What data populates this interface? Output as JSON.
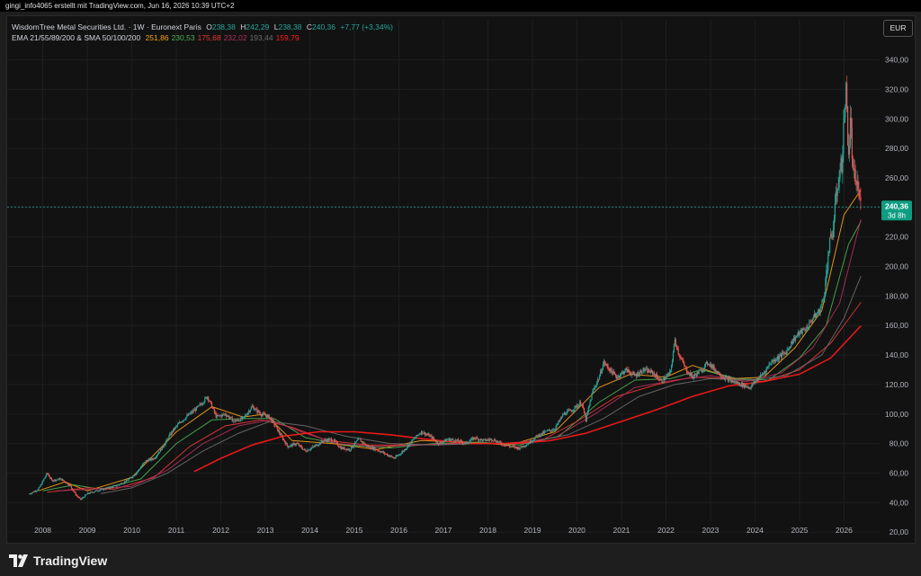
{
  "header": {
    "text": "gingi_info4065 erstellt mit TradingView.com, Jun 16, 2026 10:39 UTC+2"
  },
  "legend": {
    "instrument": "WisdomTree Metal Securities Ltd. · 1W · Euronext Paris",
    "o_label": "O",
    "o_value": "238,38",
    "h_label": "H",
    "h_value": "242,29",
    "l_label": "L",
    "l_value": "238,38",
    "c_label": "C",
    "c_value": "240,36",
    "change": "+7,77 (+3,34%)",
    "indicator_name": "EMA 21/55/89/200 & SMA 50/100/200",
    "indicator_values": [
      {
        "value": "251,86",
        "color": "#f7a21b"
      },
      {
        "value": "230,53",
        "color": "#4caf50"
      },
      {
        "value": "175,68",
        "color": "#e53935"
      },
      {
        "value": "232,02",
        "color": "#b0305a"
      },
      {
        "value": "193,44",
        "color": "#6d6d6d"
      },
      {
        "value": "159,79",
        "color": "#ff1a1a"
      }
    ]
  },
  "currency": "EUR",
  "price_badge": {
    "price": "240,36",
    "countdown": "3d 8h"
  },
  "footer": {
    "brand": "TradingView"
  },
  "chart_data": {
    "type": "candlestick",
    "ylim": [
      14,
      355
    ],
    "y_ticks": [
      20,
      40,
      60,
      80,
      100,
      120,
      140,
      160,
      180,
      200,
      220,
      240,
      260,
      280,
      300,
      320,
      340
    ],
    "y_tick_labels": [
      "20,00",
      "40,00",
      "60,00",
      "80,00",
      "100,00",
      "120,00",
      "140,00",
      "160,00",
      "180,00",
      "200,00",
      "220,00",
      "240,00",
      "260,00",
      "280,00",
      "300,00",
      "320,00",
      "340,00"
    ],
    "x_ticks": [
      2008,
      2009,
      2010,
      2011,
      2012,
      2013,
      2014,
      2015,
      2016,
      2017,
      2018,
      2019,
      2020,
      2021,
      2022,
      2023,
      2024,
      2025,
      2026
    ],
    "x_range": [
      2007.2,
      2026.8
    ],
    "last_price": 240.36,
    "colors": {
      "up": "#26a69a",
      "down": "#ef5350",
      "grid": "#1f1f1f",
      "axis_text": "#b2b5be",
      "current_line": "#26a69a",
      "badge": "#0f9d82"
    },
    "close_series": [
      [
        2007.7,
        46
      ],
      [
        2007.9,
        49
      ],
      [
        2008.1,
        60
      ],
      [
        2008.2,
        55
      ],
      [
        2008.4,
        56
      ],
      [
        2008.6,
        52
      ],
      [
        2008.75,
        45
      ],
      [
        2008.85,
        42
      ],
      [
        2009.0,
        46
      ],
      [
        2009.2,
        48
      ],
      [
        2009.5,
        50
      ],
      [
        2009.7,
        52
      ],
      [
        2009.9,
        55
      ],
      [
        2010.1,
        60
      ],
      [
        2010.3,
        68
      ],
      [
        2010.5,
        70
      ],
      [
        2010.7,
        78
      ],
      [
        2010.9,
        88
      ],
      [
        2011.1,
        95
      ],
      [
        2011.3,
        100
      ],
      [
        2011.5,
        105
      ],
      [
        2011.7,
        112
      ],
      [
        2011.9,
        98
      ],
      [
        2012.1,
        100
      ],
      [
        2012.3,
        95
      ],
      [
        2012.5,
        97
      ],
      [
        2012.7,
        105
      ],
      [
        2012.9,
        100
      ],
      [
        2013.1,
        98
      ],
      [
        2013.3,
        88
      ],
      [
        2013.5,
        78
      ],
      [
        2013.7,
        80
      ],
      [
        2013.9,
        75
      ],
      [
        2014.1,
        78
      ],
      [
        2014.3,
        82
      ],
      [
        2014.5,
        83
      ],
      [
        2014.7,
        77
      ],
      [
        2014.9,
        76
      ],
      [
        2015.1,
        83
      ],
      [
        2015.3,
        78
      ],
      [
        2015.5,
        76
      ],
      [
        2015.7,
        73
      ],
      [
        2015.9,
        70
      ],
      [
        2016.1,
        75
      ],
      [
        2016.3,
        82
      ],
      [
        2016.5,
        88
      ],
      [
        2016.7,
        85
      ],
      [
        2016.9,
        80
      ],
      [
        2017.1,
        83
      ],
      [
        2017.3,
        82
      ],
      [
        2017.5,
        80
      ],
      [
        2017.7,
        84
      ],
      [
        2017.9,
        82
      ],
      [
        2018.1,
        83
      ],
      [
        2018.3,
        80
      ],
      [
        2018.5,
        78
      ],
      [
        2018.7,
        77
      ],
      [
        2018.9,
        80
      ],
      [
        2019.1,
        85
      ],
      [
        2019.3,
        88
      ],
      [
        2019.5,
        90
      ],
      [
        2019.7,
        100
      ],
      [
        2019.9,
        103
      ],
      [
        2020.1,
        108
      ],
      [
        2020.2,
        96
      ],
      [
        2020.35,
        115
      ],
      [
        2020.5,
        125
      ],
      [
        2020.6,
        135
      ],
      [
        2020.8,
        128
      ],
      [
        2020.9,
        125
      ],
      [
        2021.1,
        130
      ],
      [
        2021.3,
        126
      ],
      [
        2021.5,
        130
      ],
      [
        2021.7,
        128
      ],
      [
        2021.9,
        122
      ],
      [
        2022.0,
        125
      ],
      [
        2022.1,
        128
      ],
      [
        2022.2,
        150
      ],
      [
        2022.3,
        140
      ],
      [
        2022.45,
        130
      ],
      [
        2022.6,
        125
      ],
      [
        2022.8,
        130
      ],
      [
        2022.95,
        135
      ],
      [
        2023.1,
        130
      ],
      [
        2023.3,
        125
      ],
      [
        2023.5,
        122
      ],
      [
        2023.7,
        120
      ],
      [
        2023.9,
        118
      ],
      [
        2024.0,
        122
      ],
      [
        2024.2,
        128
      ],
      [
        2024.35,
        135
      ],
      [
        2024.5,
        138
      ],
      [
        2024.7,
        142
      ],
      [
        2024.85,
        150
      ],
      [
        2025.0,
        155
      ],
      [
        2025.15,
        158
      ],
      [
        2025.3,
        165
      ],
      [
        2025.45,
        170
      ],
      [
        2025.55,
        180
      ],
      [
        2025.65,
        210
      ],
      [
        2025.75,
        225
      ],
      [
        2025.85,
        255
      ],
      [
        2025.95,
        270
      ],
      [
        2026.0,
        300
      ],
      [
        2026.05,
        320
      ],
      [
        2026.1,
        275
      ],
      [
        2026.15,
        300
      ],
      [
        2026.2,
        262
      ],
      [
        2026.3,
        255
      ],
      [
        2026.38,
        240.36
      ]
    ],
    "series": [
      {
        "color": "#f7a21b",
        "points": [
          [
            2007.9,
            48
          ],
          [
            2008.5,
            54
          ],
          [
            2009.0,
            48
          ],
          [
            2010.0,
            57
          ],
          [
            2011.0,
            88
          ],
          [
            2011.8,
            105
          ],
          [
            2012.5,
            98
          ],
          [
            2013.0,
            100
          ],
          [
            2013.6,
            82
          ],
          [
            2014.5,
            80
          ],
          [
            2015.5,
            76
          ],
          [
            2016.5,
            82
          ],
          [
            2017.5,
            81
          ],
          [
            2018.5,
            79
          ],
          [
            2019.5,
            88
          ],
          [
            2020.5,
            118
          ],
          [
            2021.2,
            127
          ],
          [
            2022.0,
            125
          ],
          [
            2022.6,
            133
          ],
          [
            2023.5,
            124
          ],
          [
            2024.2,
            125
          ],
          [
            2024.9,
            145
          ],
          [
            2025.5,
            170
          ],
          [
            2026.0,
            235
          ],
          [
            2026.38,
            251.86
          ]
        ]
      },
      {
        "color": "#4caf50",
        "points": [
          [
            2008.0,
            48
          ],
          [
            2008.7,
            52
          ],
          [
            2009.3,
            49
          ],
          [
            2010.2,
            56
          ],
          [
            2011.0,
            80
          ],
          [
            2011.8,
            96
          ],
          [
            2012.6,
            97
          ],
          [
            2013.2,
            97
          ],
          [
            2013.9,
            84
          ],
          [
            2014.8,
            79
          ],
          [
            2015.8,
            77
          ],
          [
            2016.8,
            80
          ],
          [
            2017.8,
            81
          ],
          [
            2018.7,
            79
          ],
          [
            2019.6,
            85
          ],
          [
            2020.5,
            108
          ],
          [
            2021.3,
            123
          ],
          [
            2022.1,
            124
          ],
          [
            2022.8,
            130
          ],
          [
            2023.6,
            124
          ],
          [
            2024.3,
            123
          ],
          [
            2025.0,
            138
          ],
          [
            2025.6,
            160
          ],
          [
            2026.1,
            215
          ],
          [
            2026.38,
            230.53
          ]
        ]
      },
      {
        "color": "#e53935",
        "points": [
          [
            2008.1,
            47
          ],
          [
            2009.0,
            50
          ],
          [
            2009.6,
            49
          ],
          [
            2010.5,
            57
          ],
          [
            2011.3,
            78
          ],
          [
            2012.1,
            92
          ],
          [
            2012.9,
            96
          ],
          [
            2013.6,
            91
          ],
          [
            2014.4,
            82
          ],
          [
            2015.3,
            79
          ],
          [
            2016.3,
            79
          ],
          [
            2017.3,
            80
          ],
          [
            2018.3,
            80
          ],
          [
            2019.2,
            82
          ],
          [
            2020.0,
            95
          ],
          [
            2020.9,
            112
          ],
          [
            2021.8,
            120
          ],
          [
            2022.6,
            125
          ],
          [
            2023.4,
            124
          ],
          [
            2024.2,
            122
          ],
          [
            2025.0,
            130
          ],
          [
            2025.7,
            148
          ],
          [
            2026.38,
            175.68
          ]
        ]
      },
      {
        "color": "#b0305a",
        "points": [
          [
            2008.3,
            48
          ],
          [
            2009.1,
            49
          ],
          [
            2010.0,
            51
          ],
          [
            2010.8,
            62
          ],
          [
            2011.6,
            80
          ],
          [
            2012.4,
            92
          ],
          [
            2013.1,
            96
          ],
          [
            2013.8,
            88
          ],
          [
            2014.6,
            80
          ],
          [
            2015.5,
            78
          ],
          [
            2016.5,
            79
          ],
          [
            2017.5,
            80
          ],
          [
            2018.5,
            80
          ],
          [
            2019.5,
            84
          ],
          [
            2020.4,
            100
          ],
          [
            2021.3,
            118
          ],
          [
            2022.2,
            123
          ],
          [
            2023.0,
            126
          ],
          [
            2023.8,
            122
          ],
          [
            2024.6,
            128
          ],
          [
            2025.3,
            145
          ],
          [
            2025.9,
            175
          ],
          [
            2026.38,
            232.02
          ]
        ]
      },
      {
        "color": "#6d6d6d",
        "points": [
          [
            2009.3,
            46
          ],
          [
            2010.0,
            50
          ],
          [
            2010.8,
            60
          ],
          [
            2011.6,
            75
          ],
          [
            2012.4,
            87
          ],
          [
            2013.1,
            95
          ],
          [
            2013.9,
            92
          ],
          [
            2014.8,
            85
          ],
          [
            2015.8,
            80
          ],
          [
            2016.8,
            79
          ],
          [
            2017.8,
            80
          ],
          [
            2018.8,
            80
          ],
          [
            2019.8,
            86
          ],
          [
            2020.6,
            97
          ],
          [
            2021.4,
            112
          ],
          [
            2022.2,
            120
          ],
          [
            2023.0,
            124
          ],
          [
            2023.9,
            123
          ],
          [
            2024.7,
            126
          ],
          [
            2025.5,
            140
          ],
          [
            2026.0,
            165
          ],
          [
            2026.38,
            193.44
          ]
        ]
      },
      {
        "color": "#ff1a1a",
        "points": [
          [
            2011.4,
            61
          ],
          [
            2012.0,
            70
          ],
          [
            2012.7,
            79
          ],
          [
            2013.4,
            85
          ],
          [
            2014.2,
            88
          ],
          [
            2015.0,
            88
          ],
          [
            2015.8,
            86
          ],
          [
            2016.6,
            83
          ],
          [
            2017.6,
            80
          ],
          [
            2018.6,
            80
          ],
          [
            2019.4,
            82
          ],
          [
            2020.2,
            87
          ],
          [
            2021.0,
            95
          ],
          [
            2021.8,
            103
          ],
          [
            2022.6,
            112
          ],
          [
            2023.4,
            119
          ],
          [
            2024.2,
            122
          ],
          [
            2025.0,
            127
          ],
          [
            2025.7,
            138
          ],
          [
            2026.38,
            159.79
          ]
        ]
      }
    ]
  }
}
